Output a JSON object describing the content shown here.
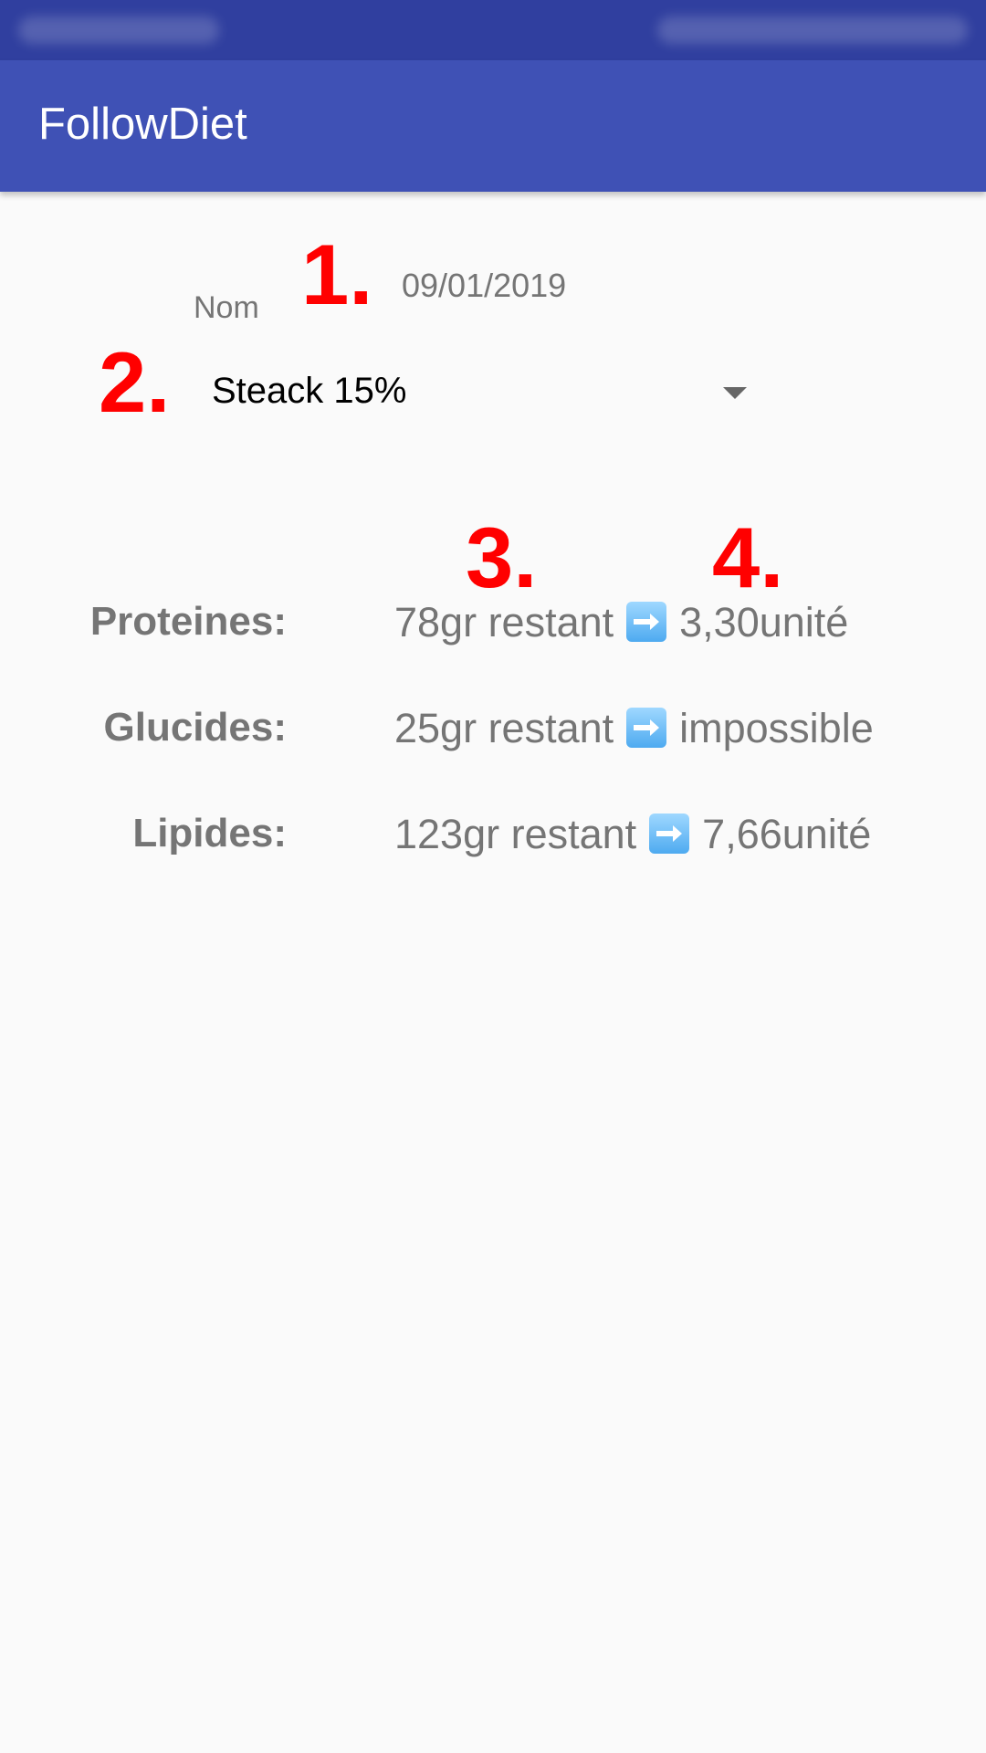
{
  "app": {
    "title": "FollowDiet"
  },
  "form": {
    "date": "09/01/2019",
    "name_label": "Nom",
    "selected_food": "Steack 15%"
  },
  "annotations": [
    "1.",
    "2.",
    "3.",
    "4."
  ],
  "macros": [
    {
      "label": "Proteines:",
      "remaining": "78gr restant",
      "result": "3,30unité"
    },
    {
      "label": "Glucides:",
      "remaining": "25gr restant",
      "result": "impossible"
    },
    {
      "label": "Lipides:",
      "remaining": "123gr restant",
      "result": "7,66unité"
    }
  ],
  "colors": {
    "app_bar": "#3f51b5",
    "status_bar": "#303f9f",
    "annotation": "#ff0000",
    "text_secondary": "#757575",
    "background": "#fafafa"
  },
  "icons": {
    "dropdown": "triangle-down",
    "arrow": "right-arrow-emoji"
  }
}
